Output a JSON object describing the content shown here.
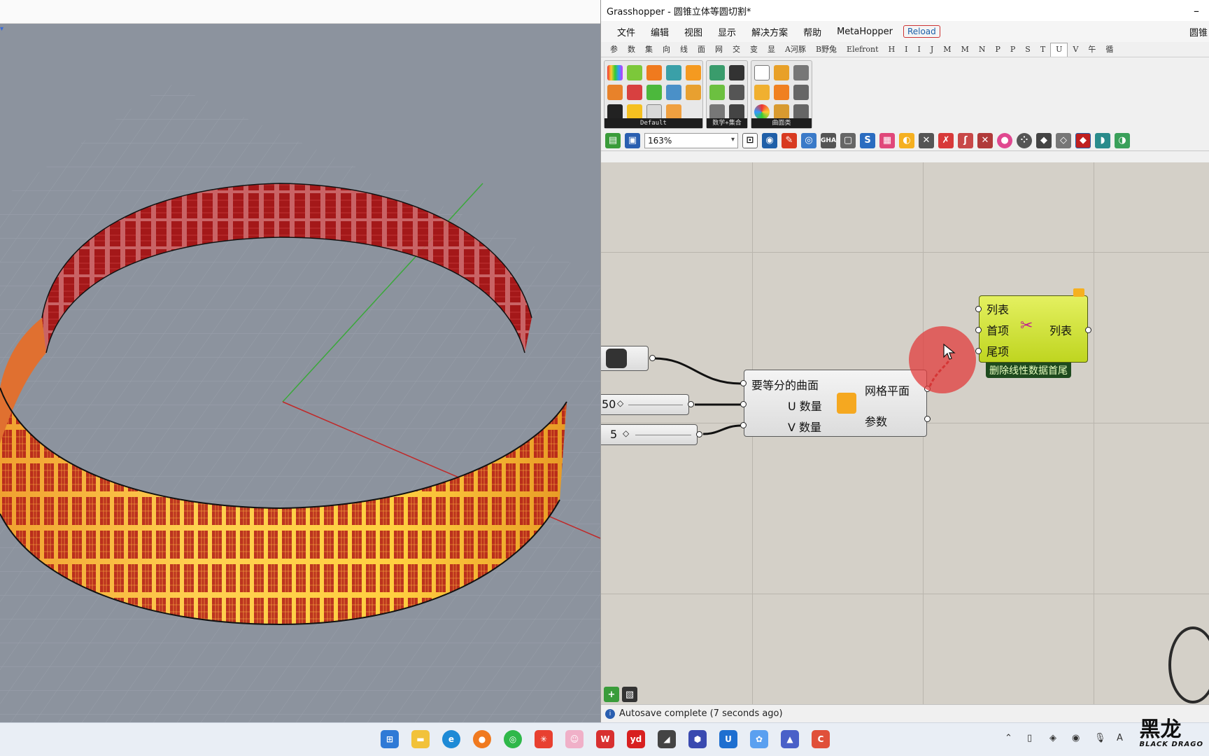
{
  "gh": {
    "title": "Grasshopper - 圆锥立体等圆切割*",
    "menu": [
      "文件",
      "编辑",
      "视图",
      "显示",
      "解决方案",
      "帮助",
      "MetaHopper"
    ],
    "reload_label": "Reload",
    "menu_right": "圆锥",
    "tabs": [
      "参",
      "数",
      "集",
      "向",
      "线",
      "面",
      "网",
      "交",
      "变",
      "显",
      "A河豚",
      "B野兔",
      "Elefront",
      "H",
      "I",
      "I",
      "J",
      "M",
      "M",
      "N",
      "P",
      "P",
      "S",
      "T",
      "U",
      "V",
      "午",
      "循"
    ],
    "active_tab_index": 24,
    "panels": [
      "Default",
      "数学+集合",
      "曲面类"
    ],
    "zoom": "163%",
    "status": "Autosave complete (7 seconds ago)"
  },
  "canvas": {
    "surface_component": {
      "inputs": [
        "要等分的曲面",
        "U 数量",
        "V 数量"
      ],
      "outputs": [
        "网格平面",
        "参数"
      ]
    },
    "slider_u": "50",
    "slider_v": "5",
    "cull_component": {
      "inputs": [
        "列表",
        "首项",
        "尾项"
      ],
      "output": "列表",
      "nickname": "删除线性数据首尾"
    }
  },
  "watermark": {
    "main": "黑龙",
    "sub": "BLACK DRAGO"
  }
}
